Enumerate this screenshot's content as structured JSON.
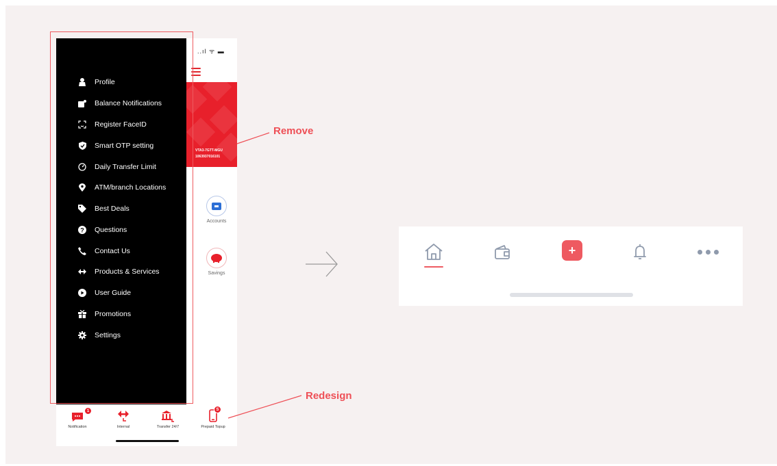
{
  "phone": {
    "status_icons": "..ıl ᯤ ▬",
    "card_lines": [
      "VTA3-7GTT-MGU",
      "1063937016101"
    ],
    "shortcuts": [
      {
        "label": "Accounts",
        "icon": "card-icon"
      },
      {
        "label": "Savings",
        "icon": "piggy-bank-icon"
      }
    ]
  },
  "drawer": {
    "items": [
      {
        "label": "Profile",
        "icon": "person-icon"
      },
      {
        "label": "Balance Notifications",
        "icon": "notification-card-icon"
      },
      {
        "label": "Register FaceID",
        "icon": "faceid-icon"
      },
      {
        "label": "Smart OTP setting",
        "icon": "shield-icon"
      },
      {
        "label": "Daily Transfer Limit",
        "icon": "gauge-icon"
      },
      {
        "label": "ATM/branch Locations",
        "icon": "location-pin-icon"
      },
      {
        "label": "Best Deals",
        "icon": "tag-icon"
      },
      {
        "label": "Questions",
        "icon": "question-icon"
      },
      {
        "label": "Contact Us",
        "icon": "phone-icon"
      },
      {
        "label": "Products & Services",
        "icon": "arrows-icon"
      },
      {
        "label": "User Guide",
        "icon": "play-icon"
      },
      {
        "label": "Promotions",
        "icon": "gift-icon"
      },
      {
        "label": "Settings",
        "icon": "gear-icon"
      }
    ]
  },
  "tabbar": {
    "tabs": [
      {
        "label": "Notification",
        "icon": "chat-icon",
        "badge": "1"
      },
      {
        "label": "Internal",
        "icon": "transfer-icon",
        "badge": ""
      },
      {
        "label": "Transfer 24/7",
        "icon": "bank-icon",
        "badge": ""
      },
      {
        "label": "Prepaid Topup",
        "icon": "mobile-icon",
        "badge": "S"
      }
    ]
  },
  "annotations": {
    "remove": "Remove",
    "redesign": "Redesign"
  },
  "new_bar": {
    "items": [
      "home-icon",
      "wallet-icon",
      "plus-icon",
      "bell-icon",
      "more-icon"
    ],
    "plus_label": "+"
  },
  "colors": {
    "accent": "#ee5a61",
    "brand_red": "#e8202b",
    "icon_gray": "#8f9aac",
    "canvas": "#f6f1f1"
  }
}
